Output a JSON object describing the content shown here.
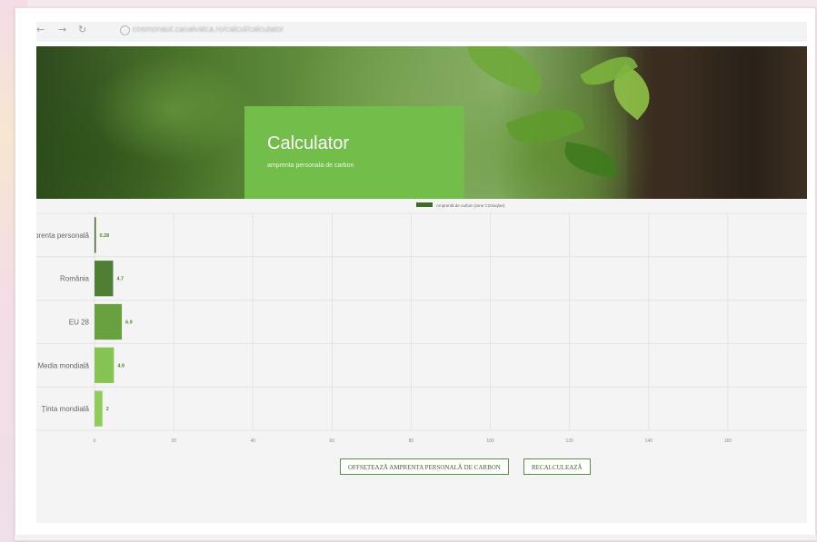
{
  "browser": {
    "url_text": "cosmonaut.canalvalca.ro/calcul/calculator"
  },
  "hero": {
    "title": "Calculator",
    "subtitle": "amprenta personala de carbon"
  },
  "chart_data": {
    "type": "bar",
    "orientation": "horizontal",
    "categories": [
      "Amprenta personală",
      "România",
      "EU 28",
      "Media mondială",
      "Ținta mondială"
    ],
    "series": [
      {
        "name": "Amprentă de carbon (tone CO2eq/an)",
        "values": [
          0.28,
          4.7,
          6.9,
          4.9,
          2
        ],
        "value_labels": [
          "0.28",
          "4.7",
          "6.9",
          "4.9",
          "2"
        ]
      }
    ],
    "bar_colors": [
      "#3f6b2a",
      "#4e7f33",
      "#69a040",
      "#86c353",
      "#8fcc5c"
    ],
    "xlim": [
      0,
      180
    ],
    "x_ticks": [
      "0",
      "20",
      "40",
      "60",
      "80",
      "100",
      "120",
      "140",
      "160"
    ],
    "grid": true,
    "legend": "top-center",
    "legend_color": "#3f6b2a"
  },
  "actions": {
    "offset_label": "OFFSETEAZĂ AMPRENTA PERSONALĂ DE CARBON",
    "recalc_label": "RECALCULEAZĂ"
  }
}
